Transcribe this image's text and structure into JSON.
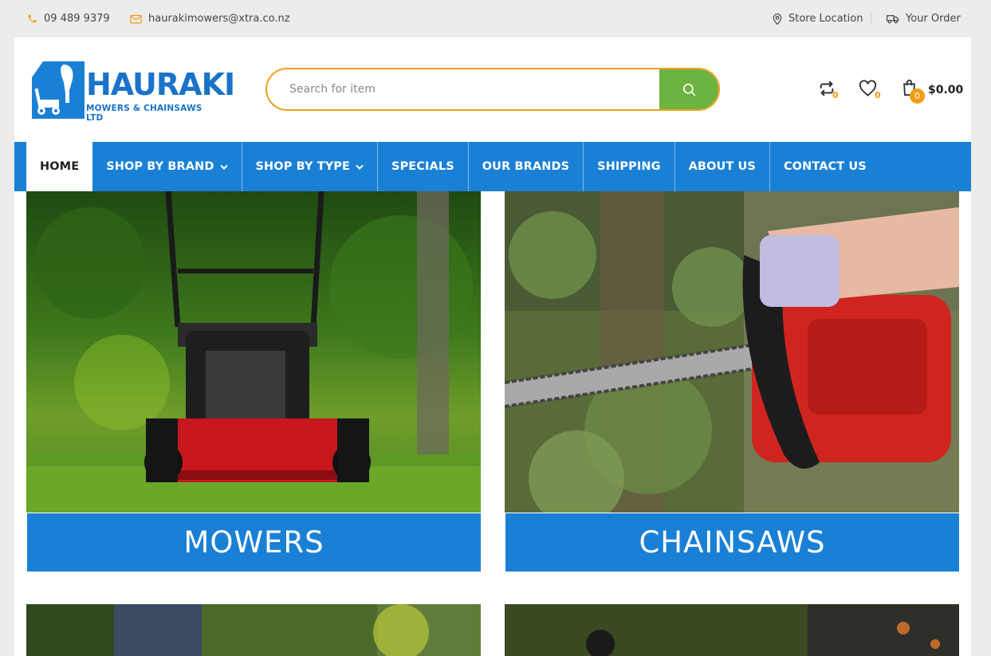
{
  "topbar": {
    "phone": "09 489 9379",
    "email": "haurakimowers@xtra.co.nz",
    "store_location": "Store Location",
    "your_order": "Your Order"
  },
  "logo": {
    "brand": "HAURAKI",
    "subtitle": "MOWERS & CHAINSAWS LTD"
  },
  "search": {
    "placeholder": "Search for item"
  },
  "header_icons": {
    "compare_count": "0",
    "wishlist_count": "0",
    "cart_count": "0",
    "cart_total": "$0.00"
  },
  "nav": {
    "items": [
      {
        "label": "HOME"
      },
      {
        "label": "SHOP BY BRAND"
      },
      {
        "label": "SHOP BY TYPE"
      },
      {
        "label": "SPECIALS"
      },
      {
        "label": "OUR BRANDS"
      },
      {
        "label": "SHIPPING"
      },
      {
        "label": "ABOUT US"
      },
      {
        "label": "CONTACT US"
      }
    ]
  },
  "categories": [
    {
      "label": "MOWERS",
      "icon": "lawn-mower-photo"
    },
    {
      "label": "CHAINSAWS",
      "icon": "chainsaw-photo"
    }
  ],
  "colors": {
    "nav_blue": "#1a80d6",
    "accent_orange": "#f39c12",
    "search_green": "#6cb33f"
  }
}
